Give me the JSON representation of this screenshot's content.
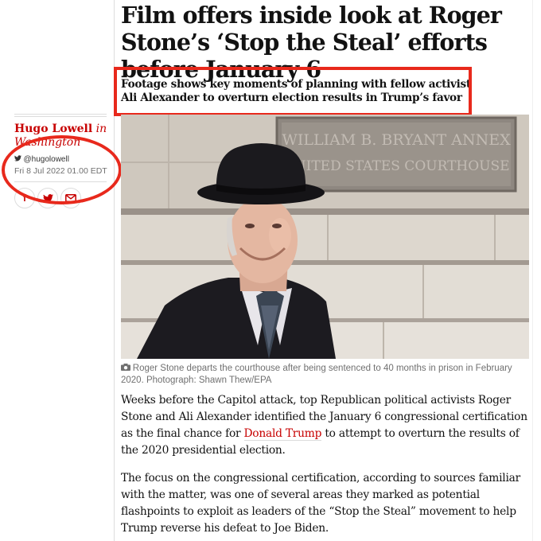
{
  "article": {
    "headline": "Film offers inside look at Roger Stone’s ‘Stop the Steal’ efforts before January 6",
    "standfirst": "Footage shows key moments of planning with fellow activist Ali Alexander to overturn election results in Trump’s favor",
    "byline": {
      "name": "Hugo Lowell",
      "location": "in Washington",
      "twitter_handle": "@hugolowell",
      "date": "Fri 8 Jul 2022 01.00 EDT"
    },
    "share": {
      "facebook": "f",
      "twitter_icon": "twitter-bird-icon",
      "email_icon": "envelope-icon"
    },
    "image": {
      "sign_line1": "WILLIAM B. BRYANT ANNEX",
      "sign_line2": "UNITED STATES COURTHOUSE"
    },
    "caption": "Roger Stone departs the courthouse after being sentenced to 40 months in prison in February 2020. Photograph: Shawn Thew/EPA",
    "body": {
      "p1_before": "Weeks before the Capitol attack, top Republican political activists Roger Stone and Ali Alexander identified the January 6 congressional certification as the final chance for ",
      "p1_link": "Donald Trump",
      "p1_after": " to attempt to overturn the results of the 2020 presidential election.",
      "p2": "The focus on the congressional certification, according to sources familiar with the matter, was one of several areas they marked as potential flashpoints to exploit as leaders of the “Stop the Steal” movement to help Trump reverse his defeat to Joe Biden."
    }
  },
  "colors": {
    "accent": "#c70000",
    "annotation": "#e8291c"
  }
}
